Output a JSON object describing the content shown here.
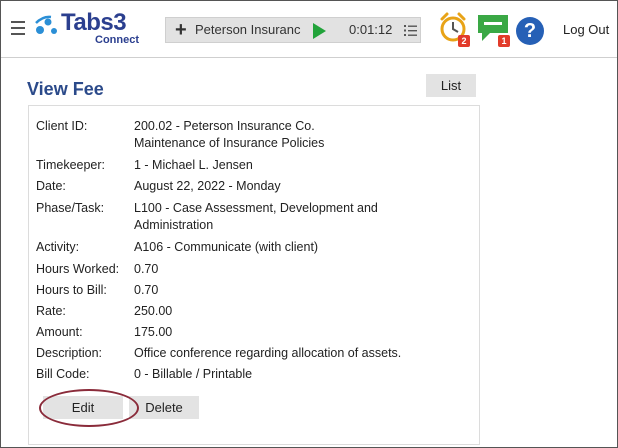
{
  "header": {
    "logo_word": "Tabs3",
    "logo_sub": "Connect",
    "timer": {
      "add_icon": "plus-icon",
      "client": "Peterson Insuranc",
      "play_icon": "play-icon",
      "elapsed": "0:01:12",
      "list_icon": "list-icon"
    },
    "alarm_badge": "2",
    "chat_badge": "1",
    "help_label": "?",
    "logout_label": "Log Out"
  },
  "page": {
    "title": "View Fee",
    "list_button": "List"
  },
  "fee": {
    "rows": [
      {
        "label": "Client ID:",
        "value": "200.02 - Peterson Insurance Co.",
        "value2": "Maintenance of Insurance Policies"
      },
      {
        "label": "Timekeeper:",
        "value": "1 - Michael L. Jensen"
      },
      {
        "label": "Date:",
        "value": "August 22, 2022 - Monday"
      },
      {
        "label": "Phase/Task:",
        "value": "L100 - Case Assessment, Development and",
        "value2": "Administration"
      },
      {
        "label": "Activity:",
        "value": "A106 - Communicate (with client)"
      },
      {
        "label": "Hours Worked:",
        "value": "0.70"
      },
      {
        "label": "Hours to Bill:",
        "value": "0.70"
      },
      {
        "label": "Rate:",
        "value": "250.00"
      },
      {
        "label": "Amount:",
        "value": "175.00"
      },
      {
        "label": "Description:",
        "value": "Office conference regarding allocation of assets."
      },
      {
        "label": "Bill Code:",
        "value": "0 - Billable / Printable"
      }
    ],
    "edit_button": "Edit",
    "delete_button": "Delete"
  },
  "colors": {
    "title": "#2b4a8a",
    "logo": "#2b3f8f",
    "play": "#22a33a",
    "badge": "#e23b2a",
    "help": "#2660b6",
    "highlight": "#8a2b3a"
  }
}
